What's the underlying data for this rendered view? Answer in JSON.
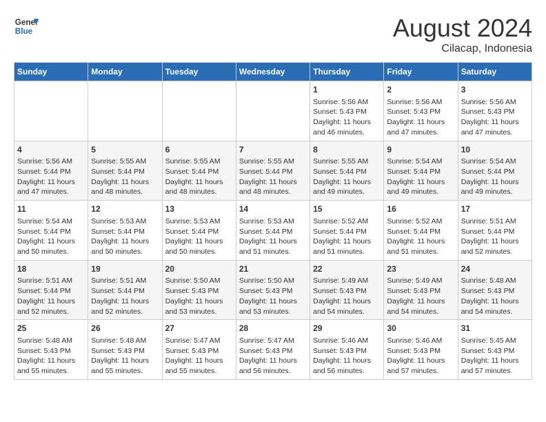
{
  "header": {
    "logo_line1": "General",
    "logo_line2": "Blue",
    "main_title": "August 2024",
    "subtitle": "Cilacap, Indonesia"
  },
  "days_of_week": [
    "Sunday",
    "Monday",
    "Tuesday",
    "Wednesday",
    "Thursday",
    "Friday",
    "Saturday"
  ],
  "weeks": [
    [
      {
        "day": "",
        "info": ""
      },
      {
        "day": "",
        "info": ""
      },
      {
        "day": "",
        "info": ""
      },
      {
        "day": "",
        "info": ""
      },
      {
        "day": "1",
        "info": "Sunrise: 5:56 AM\nSunset: 5:43 PM\nDaylight: 11 hours\nand 46 minutes."
      },
      {
        "day": "2",
        "info": "Sunrise: 5:56 AM\nSunset: 5:43 PM\nDaylight: 11 hours\nand 47 minutes."
      },
      {
        "day": "3",
        "info": "Sunrise: 5:56 AM\nSunset: 5:43 PM\nDaylight: 11 hours\nand 47 minutes."
      }
    ],
    [
      {
        "day": "4",
        "info": "Sunrise: 5:56 AM\nSunset: 5:44 PM\nDaylight: 11 hours\nand 47 minutes."
      },
      {
        "day": "5",
        "info": "Sunrise: 5:55 AM\nSunset: 5:44 PM\nDaylight: 11 hours\nand 48 minutes."
      },
      {
        "day": "6",
        "info": "Sunrise: 5:55 AM\nSunset: 5:44 PM\nDaylight: 11 hours\nand 48 minutes."
      },
      {
        "day": "7",
        "info": "Sunrise: 5:55 AM\nSunset: 5:44 PM\nDaylight: 11 hours\nand 48 minutes."
      },
      {
        "day": "8",
        "info": "Sunrise: 5:55 AM\nSunset: 5:44 PM\nDaylight: 11 hours\nand 49 minutes."
      },
      {
        "day": "9",
        "info": "Sunrise: 5:54 AM\nSunset: 5:44 PM\nDaylight: 11 hours\nand 49 minutes."
      },
      {
        "day": "10",
        "info": "Sunrise: 5:54 AM\nSunset: 5:44 PM\nDaylight: 11 hours\nand 49 minutes."
      }
    ],
    [
      {
        "day": "11",
        "info": "Sunrise: 5:54 AM\nSunset: 5:44 PM\nDaylight: 11 hours\nand 50 minutes."
      },
      {
        "day": "12",
        "info": "Sunrise: 5:53 AM\nSunset: 5:44 PM\nDaylight: 11 hours\nand 50 minutes."
      },
      {
        "day": "13",
        "info": "Sunrise: 5:53 AM\nSunset: 5:44 PM\nDaylight: 11 hours\nand 50 minutes."
      },
      {
        "day": "14",
        "info": "Sunrise: 5:53 AM\nSunset: 5:44 PM\nDaylight: 11 hours\nand 51 minutes."
      },
      {
        "day": "15",
        "info": "Sunrise: 5:52 AM\nSunset: 5:44 PM\nDaylight: 11 hours\nand 51 minutes."
      },
      {
        "day": "16",
        "info": "Sunrise: 5:52 AM\nSunset: 5:44 PM\nDaylight: 11 hours\nand 51 minutes."
      },
      {
        "day": "17",
        "info": "Sunrise: 5:51 AM\nSunset: 5:44 PM\nDaylight: 11 hours\nand 52 minutes."
      }
    ],
    [
      {
        "day": "18",
        "info": "Sunrise: 5:51 AM\nSunset: 5:44 PM\nDaylight: 11 hours\nand 52 minutes."
      },
      {
        "day": "19",
        "info": "Sunrise: 5:51 AM\nSunset: 5:44 PM\nDaylight: 11 hours\nand 52 minutes."
      },
      {
        "day": "20",
        "info": "Sunrise: 5:50 AM\nSunset: 5:43 PM\nDaylight: 11 hours\nand 53 minutes."
      },
      {
        "day": "21",
        "info": "Sunrise: 5:50 AM\nSunset: 5:43 PM\nDaylight: 11 hours\nand 53 minutes."
      },
      {
        "day": "22",
        "info": "Sunrise: 5:49 AM\nSunset: 5:43 PM\nDaylight: 11 hours\nand 54 minutes."
      },
      {
        "day": "23",
        "info": "Sunrise: 5:49 AM\nSunset: 5:43 PM\nDaylight: 11 hours\nand 54 minutes."
      },
      {
        "day": "24",
        "info": "Sunrise: 5:48 AM\nSunset: 5:43 PM\nDaylight: 11 hours\nand 54 minutes."
      }
    ],
    [
      {
        "day": "25",
        "info": "Sunrise: 5:48 AM\nSunset: 5:43 PM\nDaylight: 11 hours\nand 55 minutes."
      },
      {
        "day": "26",
        "info": "Sunrise: 5:48 AM\nSunset: 5:43 PM\nDaylight: 11 hours\nand 55 minutes."
      },
      {
        "day": "27",
        "info": "Sunrise: 5:47 AM\nSunset: 5:43 PM\nDaylight: 11 hours\nand 55 minutes."
      },
      {
        "day": "28",
        "info": "Sunrise: 5:47 AM\nSunset: 5:43 PM\nDaylight: 11 hours\nand 56 minutes."
      },
      {
        "day": "29",
        "info": "Sunrise: 5:46 AM\nSunset: 5:43 PM\nDaylight: 11 hours\nand 56 minutes."
      },
      {
        "day": "30",
        "info": "Sunrise: 5:46 AM\nSunset: 5:43 PM\nDaylight: 11 hours\nand 57 minutes."
      },
      {
        "day": "31",
        "info": "Sunrise: 5:45 AM\nSunset: 5:43 PM\nDaylight: 11 hours\nand 57 minutes."
      }
    ]
  ]
}
